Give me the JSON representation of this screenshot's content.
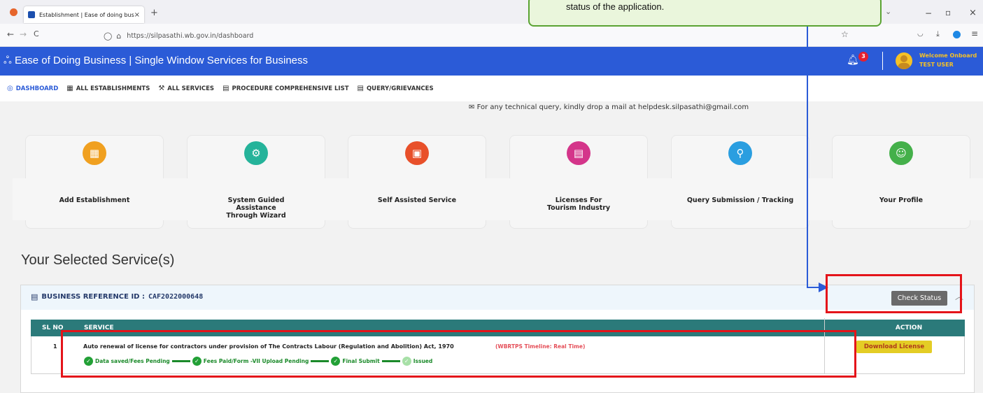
{
  "browser": {
    "tab_title": "Establishment | Ease of doing busin",
    "tab_close": "×",
    "new_tab": "+",
    "url_host": "https://silpasathi.wb.gov.in/dashboard",
    "nav_back": "←",
    "nav_forward": "→",
    "nav_reload": "C",
    "window_minimize": "−",
    "window_restore": "▫",
    "window_close": "×"
  },
  "header": {
    "title": "Ease of Doing Business | Single Window Services for Business",
    "notification_count": "3",
    "welcome": "Welcome Onboard",
    "user_name": "TEST USER"
  },
  "menu": {
    "items": [
      {
        "label": "DASHBOARD",
        "icon": "dashboard-icon"
      },
      {
        "label": "ALL ESTABLISHMENTS",
        "icon": "building-icon"
      },
      {
        "label": "ALL SERVICES",
        "icon": "wrench-icon"
      },
      {
        "label": "PROCEDURE COMPREHENSIVE LIST",
        "icon": "list-icon"
      },
      {
        "label": "QUERY/GRIEVANCES",
        "icon": "list-icon"
      }
    ]
  },
  "helpline": "For any technical query, kindly drop a mail at helpdesk.silpasathi@gmail.com",
  "cards": [
    {
      "label": "Add Establishment",
      "color": "#f0a020"
    },
    {
      "label": "System Guided Assistance Through Wizard",
      "color": "#25b39a"
    },
    {
      "label": "Self Assisted Service",
      "color": "#e8502a"
    },
    {
      "label": "Licenses For Tourism Industry",
      "color": "#d4358a"
    },
    {
      "label": "Query Submission / Tracking",
      "color": "#2a9ee0"
    },
    {
      "label": "Your Profile",
      "color": "#44b04a"
    }
  ],
  "selected": {
    "title": "Your Selected Service(s)",
    "ref_label": "BUSINESS REFERENCE ID :",
    "ref_id": "CAF2022000648",
    "check_status": "Check Status",
    "columns": {
      "sl": "SL NO",
      "service": "SERVICE",
      "action": "ACTION"
    },
    "row": {
      "sl": "1",
      "service": "Auto renewal of license for contractors under provision of The Contracts Labour (Regulation and Abolition) Act, 1970",
      "timeline": "(WBRTPS Timeline: Real Time)",
      "action": "Download License",
      "steps": [
        "Data saved/Fees Pending",
        "Fees Paid/Form -VII Upload Pending",
        "Final Submit",
        "Issued"
      ]
    }
  },
  "annotation": {
    "callout_text": "status of the application."
  }
}
